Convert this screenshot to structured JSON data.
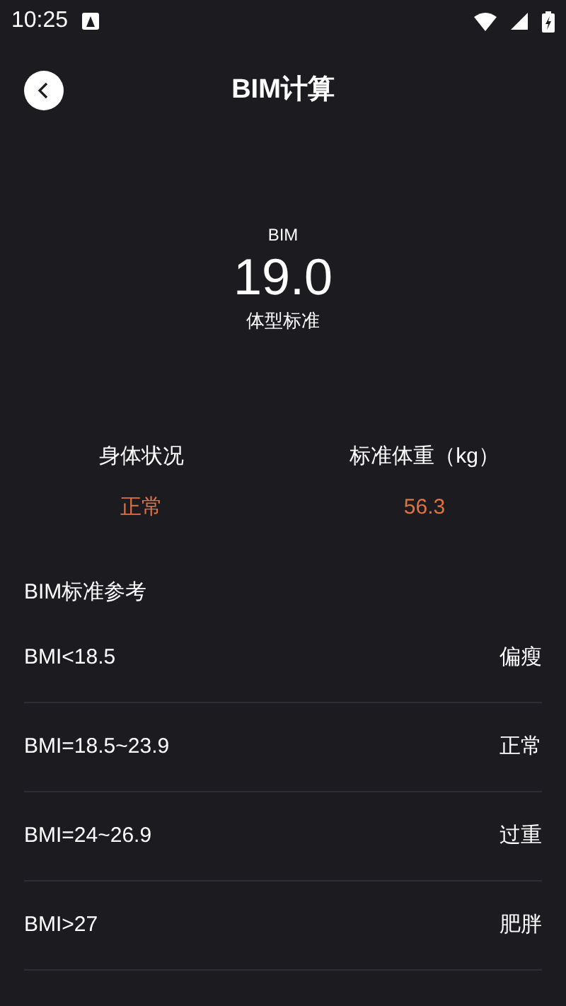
{
  "status_bar": {
    "time": "10:25"
  },
  "header": {
    "title": "BIM计算"
  },
  "result": {
    "label": "BIM",
    "value": "19.0",
    "verdict": "体型标准"
  },
  "stats": [
    {
      "label": "身体状况",
      "value": "正常"
    },
    {
      "label": "标准体重（kg）",
      "value": "56.3"
    }
  ],
  "reference": {
    "title": "BIM标准参考",
    "rows": [
      {
        "range": "BMI<18.5",
        "category": "偏瘦"
      },
      {
        "range": "BMI=18.5~23.9",
        "category": "正常"
      },
      {
        "range": "BMI=24~26.9",
        "category": "过重"
      },
      {
        "range": "BMI>27",
        "category": "肥胖"
      }
    ]
  }
}
